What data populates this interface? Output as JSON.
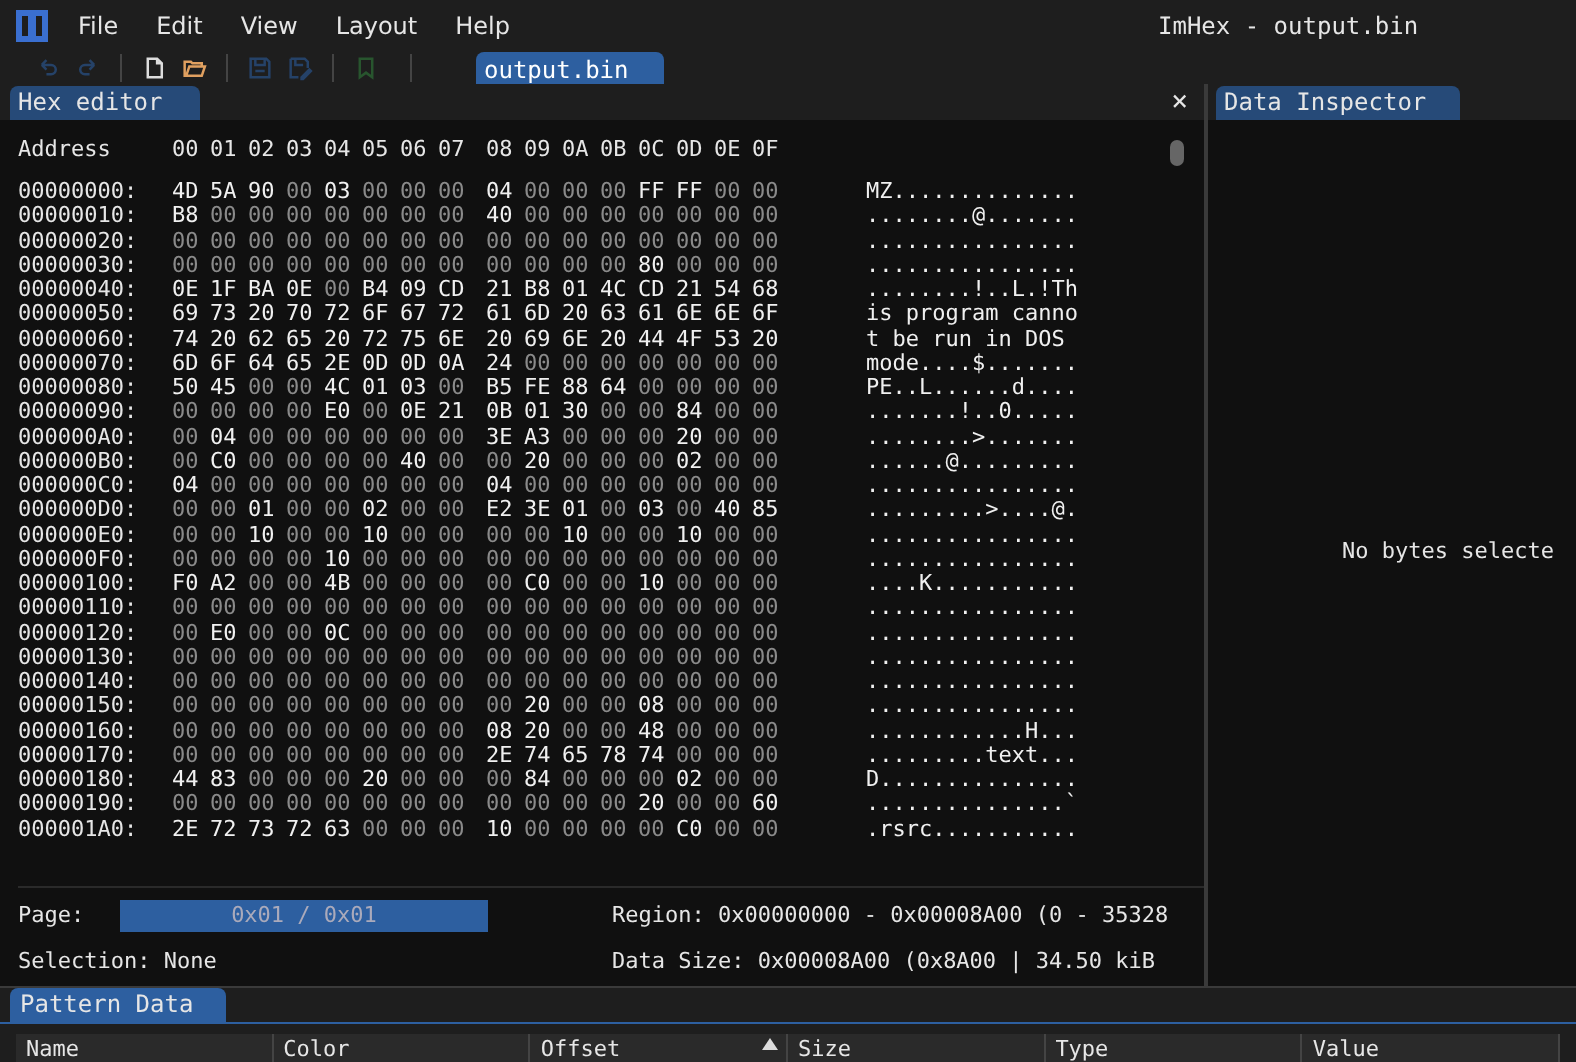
{
  "window": {
    "title": "ImHex - output.bin"
  },
  "menu": [
    "File",
    "Edit",
    "View",
    "Layout",
    "Help"
  ],
  "toolbar": [
    {
      "kind": "undo",
      "disabled": true
    },
    {
      "kind": "redo",
      "disabled": true
    },
    {
      "kind": "new",
      "disabled": false
    },
    {
      "kind": "open",
      "disabled": false
    },
    {
      "kind": "save",
      "disabled": true
    },
    {
      "kind": "saveas",
      "disabled": true
    },
    {
      "kind": "bookmark",
      "disabled": true
    }
  ],
  "file_tabs": [
    {
      "label": "output.bin",
      "selected": true
    }
  ],
  "hex_editor": {
    "title": "Hex editor",
    "close": "×",
    "address_label": "Address",
    "columns": [
      "00",
      "01",
      "02",
      "03",
      "04",
      "05",
      "06",
      "07",
      "08",
      "09",
      "0A",
      "0B",
      "0C",
      "0D",
      "0E",
      "0F"
    ],
    "rows": [
      {
        "address": "00000000:",
        "bytes": "4D 5A 90 00 03 00 00 00 04 00 00 00 FF FF 00 00",
        "ascii": "MZ.............."
      },
      {
        "address": "00000010:",
        "bytes": "B8 00 00 00 00 00 00 00 40 00 00 00 00 00 00 00",
        "ascii": "........@......."
      },
      {
        "address": "00000020:",
        "bytes": "00 00 00 00 00 00 00 00 00 00 00 00 00 00 00 00",
        "ascii": "................"
      },
      {
        "address": "00000030:",
        "bytes": "00 00 00 00 00 00 00 00 00 00 00 00 80 00 00 00",
        "ascii": "................"
      },
      {
        "address": "00000040:",
        "bytes": "0E 1F BA 0E 00 B4 09 CD 21 B8 01 4C CD 21 54 68",
        "ascii": "........!..L.!Th"
      },
      {
        "address": "00000050:",
        "bytes": "69 73 20 70 72 6F 67 72 61 6D 20 63 61 6E 6E 6F",
        "ascii": "is program canno"
      },
      {
        "address": "00000060:",
        "bytes": "74 20 62 65 20 72 75 6E 20 69 6E 20 44 4F 53 20",
        "ascii": "t be run in DOS "
      },
      {
        "address": "00000070:",
        "bytes": "6D 6F 64 65 2E 0D 0D 0A 24 00 00 00 00 00 00 00",
        "ascii": "mode....$......."
      },
      {
        "address": "00000080:",
        "bytes": "50 45 00 00 4C 01 03 00 B5 FE 88 64 00 00 00 00",
        "ascii": "PE..L......d...."
      },
      {
        "address": "00000090:",
        "bytes": "00 00 00 00 E0 00 0E 21 0B 01 30 00 00 84 00 00",
        "ascii": ".......!..0....."
      },
      {
        "address": "000000A0:",
        "bytes": "00 04 00 00 00 00 00 00 3E A3 00 00 00 20 00 00",
        "ascii": "........>......."
      },
      {
        "address": "000000B0:",
        "bytes": "00 C0 00 00 00 00 40 00 00 20 00 00 00 02 00 00",
        "ascii": "......@........."
      },
      {
        "address": "000000C0:",
        "bytes": "04 00 00 00 00 00 00 00 04 00 00 00 00 00 00 00",
        "ascii": "................"
      },
      {
        "address": "000000D0:",
        "bytes": "00 00 01 00 00 02 00 00 E2 3E 01 00 03 00 40 85",
        "ascii": ".........>....@."
      },
      {
        "address": "000000E0:",
        "bytes": "00 00 10 00 00 10 00 00 00 00 10 00 00 10 00 00",
        "ascii": "................"
      },
      {
        "address": "000000F0:",
        "bytes": "00 00 00 00 10 00 00 00 00 00 00 00 00 00 00 00",
        "ascii": "................"
      },
      {
        "address": "00000100:",
        "bytes": "F0 A2 00 00 4B 00 00 00 00 C0 00 00 10 00 00 00",
        "ascii": "....K..........."
      },
      {
        "address": "00000110:",
        "bytes": "00 00 00 00 00 00 00 00 00 00 00 00 00 00 00 00",
        "ascii": "................"
      },
      {
        "address": "00000120:",
        "bytes": "00 E0 00 00 0C 00 00 00 00 00 00 00 00 00 00 00",
        "ascii": "................"
      },
      {
        "address": "00000130:",
        "bytes": "00 00 00 00 00 00 00 00 00 00 00 00 00 00 00 00",
        "ascii": "................"
      },
      {
        "address": "00000140:",
        "bytes": "00 00 00 00 00 00 00 00 00 00 00 00 00 00 00 00",
        "ascii": "................"
      },
      {
        "address": "00000150:",
        "bytes": "00 00 00 00 00 00 00 00 00 20 00 00 08 00 00 00",
        "ascii": "................"
      },
      {
        "address": "00000160:",
        "bytes": "00 00 00 00 00 00 00 00 08 20 00 00 48 00 00 00",
        "ascii": "............H..."
      },
      {
        "address": "00000170:",
        "bytes": "00 00 00 00 00 00 00 00 2E 74 65 78 74 00 00 00",
        "ascii": ".........text..."
      },
      {
        "address": "00000180:",
        "bytes": "44 83 00 00 00 20 00 00 00 84 00 00 00 02 00 00",
        "ascii": "D..............."
      },
      {
        "address": "00000190:",
        "bytes": "00 00 00 00 00 00 00 00 00 00 00 00 20 00 00 60",
        "ascii": "...............`"
      },
      {
        "address": "000001A0:",
        "bytes": "2E 72 73 72 63 00 00 00 10 00 00 00 00 C0 00 00",
        "ascii": ".rsrc..........."
      }
    ],
    "page_label": "Page:",
    "page_value": "0x01 / 0x01",
    "selection": "Selection: None",
    "region": "Region: 0x00000000 - 0x00008A00 (0 - 35328",
    "data_size": "Data Size: 0x00008A00 (0x8A00 | 34.50 kiB"
  },
  "data_inspector": {
    "title": "Data Inspector",
    "message": "No bytes selecte"
  },
  "pattern_data": {
    "title": "Pattern Data",
    "columns": [
      {
        "label": "Name",
        "sorted": false
      },
      {
        "label": "Color",
        "sorted": false
      },
      {
        "label": "Offset",
        "sorted": true
      },
      {
        "label": "Size",
        "sorted": false
      },
      {
        "label": "Type",
        "sorted": false
      },
      {
        "label": "Value",
        "sorted": false
      }
    ]
  }
}
